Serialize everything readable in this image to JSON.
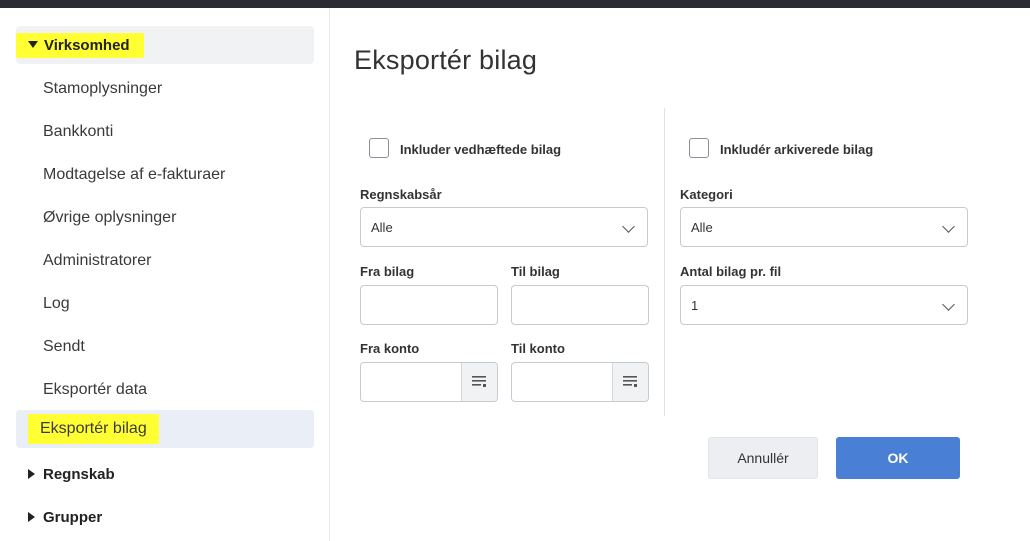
{
  "sidebar": {
    "section_virksomhed": "Virksomhed",
    "items": [
      {
        "label": "Stamoplysninger"
      },
      {
        "label": "Bankkonti"
      },
      {
        "label": "Modtagelse af e-fakturaer"
      },
      {
        "label": "Øvrige oplysninger"
      },
      {
        "label": "Administratorer"
      },
      {
        "label": "Log"
      },
      {
        "label": "Sendt"
      },
      {
        "label": "Eksportér data"
      },
      {
        "label": "Eksportér bilag"
      }
    ],
    "section_regnskab": "Regnskab",
    "section_grupper": "Grupper"
  },
  "dialog": {
    "title": "Eksportér bilag",
    "include_attached_label": "Inkluder vedhæftede bilag",
    "include_archived_label": "Inkludér arkiverede bilag",
    "fiscal_year_label": "Regnskabsår",
    "fiscal_year_value": "Alle",
    "category_label": "Kategori",
    "category_value": "Alle",
    "from_voucher_label": "Fra bilag",
    "to_voucher_label": "Til bilag",
    "vouchers_per_file_label": "Antal bilag pr. fil",
    "vouchers_per_file_value": "1",
    "from_account_label": "Fra konto",
    "to_account_label": "Til konto",
    "cancel_label": "Annullér",
    "ok_label": "OK"
  },
  "colors": {
    "highlight": "#ffff33",
    "primary": "#4a7fd6",
    "active_nav": "#e9eef7"
  }
}
